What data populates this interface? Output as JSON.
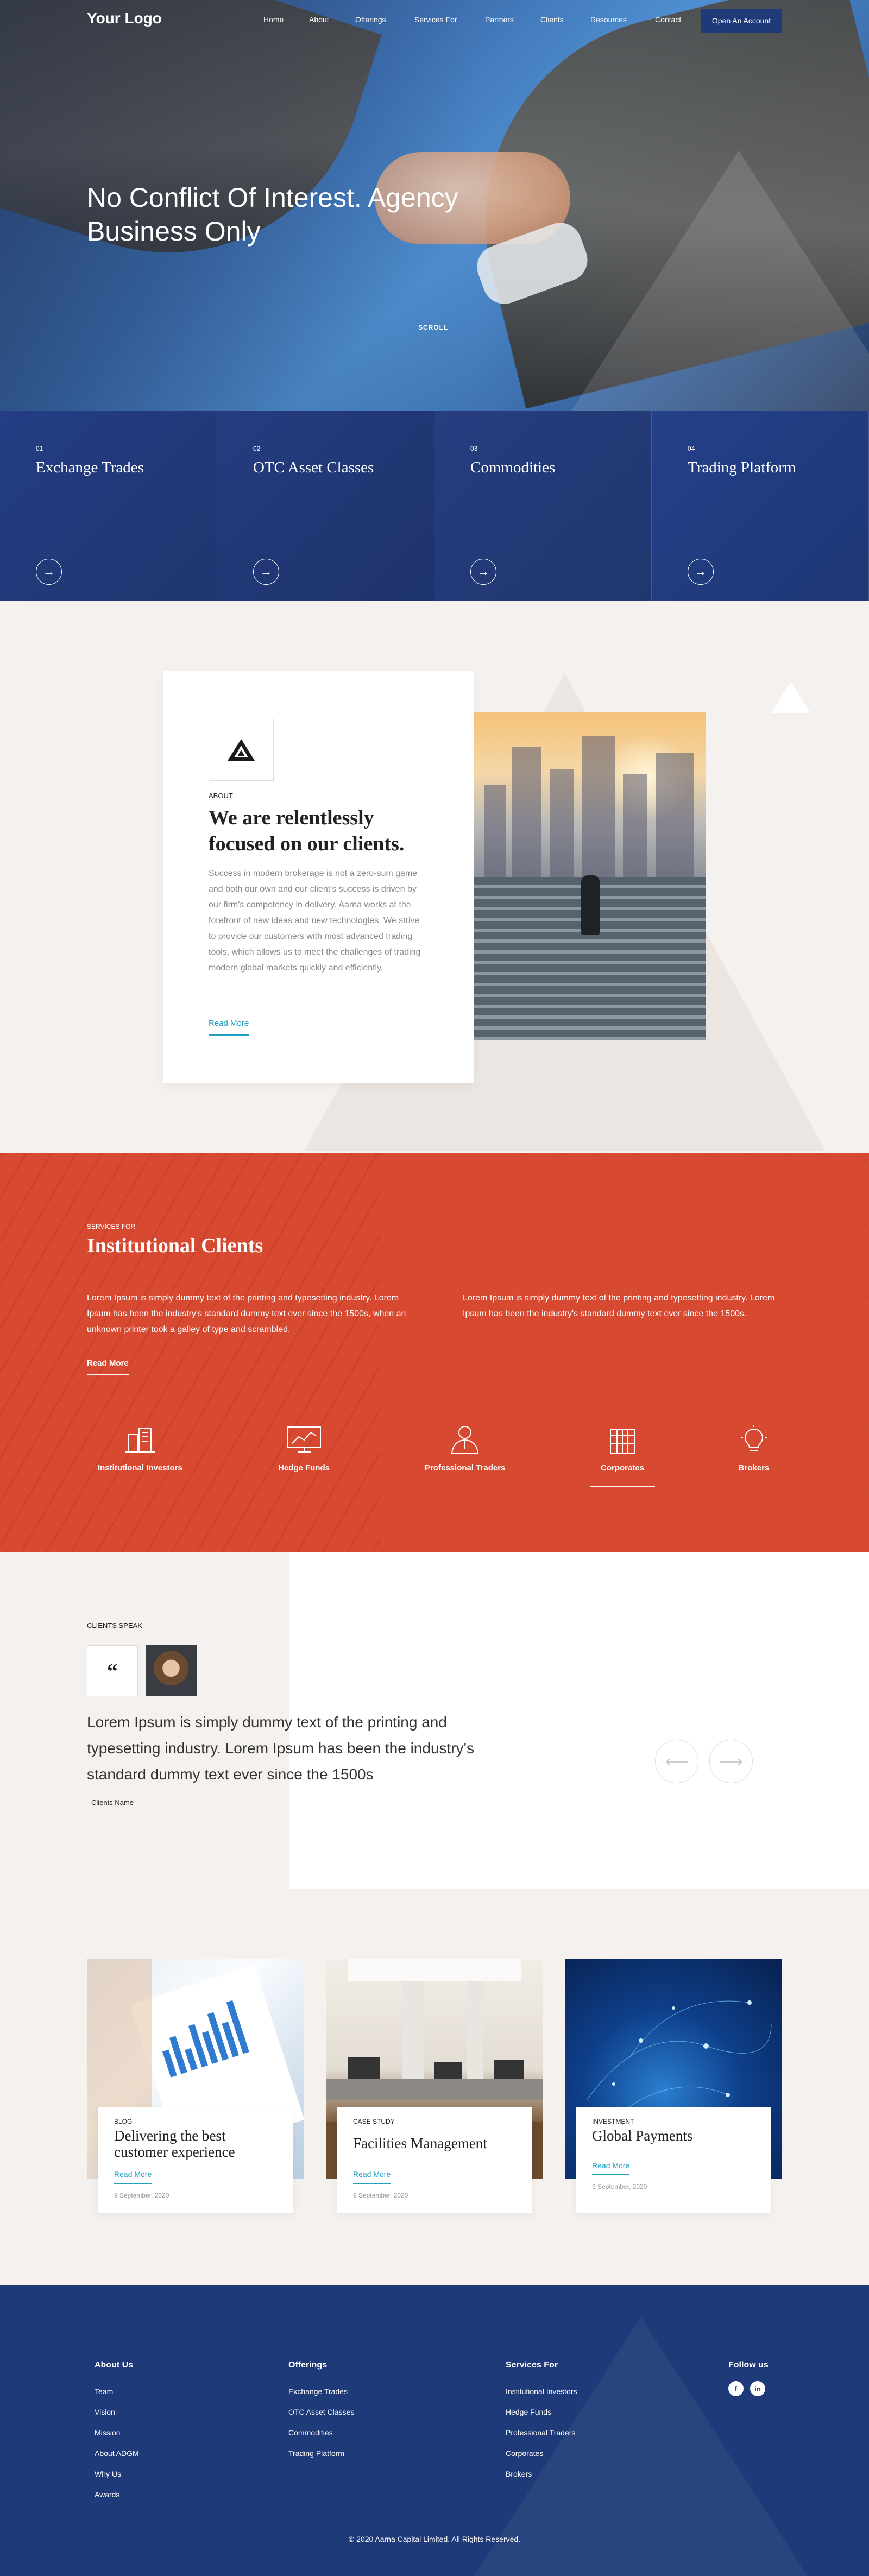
{
  "nav": {
    "logo": "Your Logo",
    "items": [
      "Home",
      "About",
      "Offerings",
      "Services For",
      "Partners",
      "Clients",
      "Resources",
      "Contact"
    ],
    "cta": "Open An Account"
  },
  "hero": {
    "title": "No Conflict Of Interest. Agency Business Only",
    "scroll": "SCROLL"
  },
  "offerings": [
    {
      "num": "01",
      "name": "Exchange Trades"
    },
    {
      "num": "02",
      "name": "OTC Asset Classes"
    },
    {
      "num": "03",
      "name": "Commodities"
    },
    {
      "num": "04",
      "name": "Trading Platform"
    }
  ],
  "about": {
    "tag": "ABOUT",
    "title": "We are relentlessly focused on our clients.",
    "text": "Success in modern brokerage is not a zero-sum game and both our own and our client's success is driven by our firm's competency in delivery. Aarna works at the forefront of new ideas and new technologies. We strive to provide our customers with most advanced trading tools, which allows us to meet the challenges of trading modern global markets quickly and efficiently.",
    "more": "Read More"
  },
  "services": {
    "tag": "SERVICES FOR",
    "title": "Institutional Clients",
    "p1": "Lorem Ipsum is simply dummy text of the printing and typesetting industry. Lorem Ipsum has been the industry's standard dummy text ever since the 1500s, when an unknown printer took a galley of type and scrambled.",
    "p2": "Lorem Ipsum is simply dummy text of the printing and typesetting industry. Lorem Ipsum has been the industry's standard dummy text ever since the 1500s.",
    "more": "Read More",
    "items": [
      {
        "label": "Institutional Investors",
        "icon": "institution-icon"
      },
      {
        "label": "Hedge Funds",
        "icon": "chart-icon"
      },
      {
        "label": "Professional Traders",
        "icon": "trader-icon"
      },
      {
        "label": "Corporates",
        "icon": "building-icon"
      },
      {
        "label": "Brokers",
        "icon": "lightbulb-icon"
      }
    ],
    "active_index": 3
  },
  "testimonial": {
    "tag": "CLIENTS SPEAK",
    "quote_mark": "“",
    "quote": "Lorem Ipsum is simply dummy text of the printing and typesetting industry. Lorem Ipsum has been the industry's standard dummy text ever since the 1500s",
    "name": "- Clients Name",
    "prev": "⟵",
    "next": "⟶"
  },
  "blog": [
    {
      "tag": "BLOG",
      "title": "Delivering the best customer experience",
      "more": "Read More",
      "date": "9 September, 2020"
    },
    {
      "tag": "CASE STUDY",
      "title": "Facilities Management",
      "more": "Read More",
      "date": "9 September, 2020"
    },
    {
      "tag": "INVESTMENT",
      "title": "Global Payments",
      "more": "Read More",
      "date": "9 September, 2020"
    }
  ],
  "footer": {
    "about": {
      "title": "About Us",
      "links": [
        "Team",
        "Vision",
        "Mission",
        "About ADGM",
        "Why Us",
        "Awards"
      ]
    },
    "offerings": {
      "title": "Offerings",
      "links": [
        "Exchange Trades",
        "OTC Asset Classes",
        "Commodities",
        "Trading Platform"
      ]
    },
    "services": {
      "title": "Services For",
      "links": [
        "Institutional Investors",
        "Hedge Funds",
        "Professional Traders",
        "Corporates",
        "Brokers"
      ]
    },
    "follow": {
      "title": "Follow us",
      "facebook": "f",
      "linkedin": "in"
    },
    "copyright": "© 2020 Aarna Capital Limited. All Rights Reserved."
  },
  "colors": {
    "navy": "#1f3a78",
    "accent_red": "#d74a31",
    "link_blue": "#1e9fc3",
    "sand": "#f4f1ee"
  }
}
